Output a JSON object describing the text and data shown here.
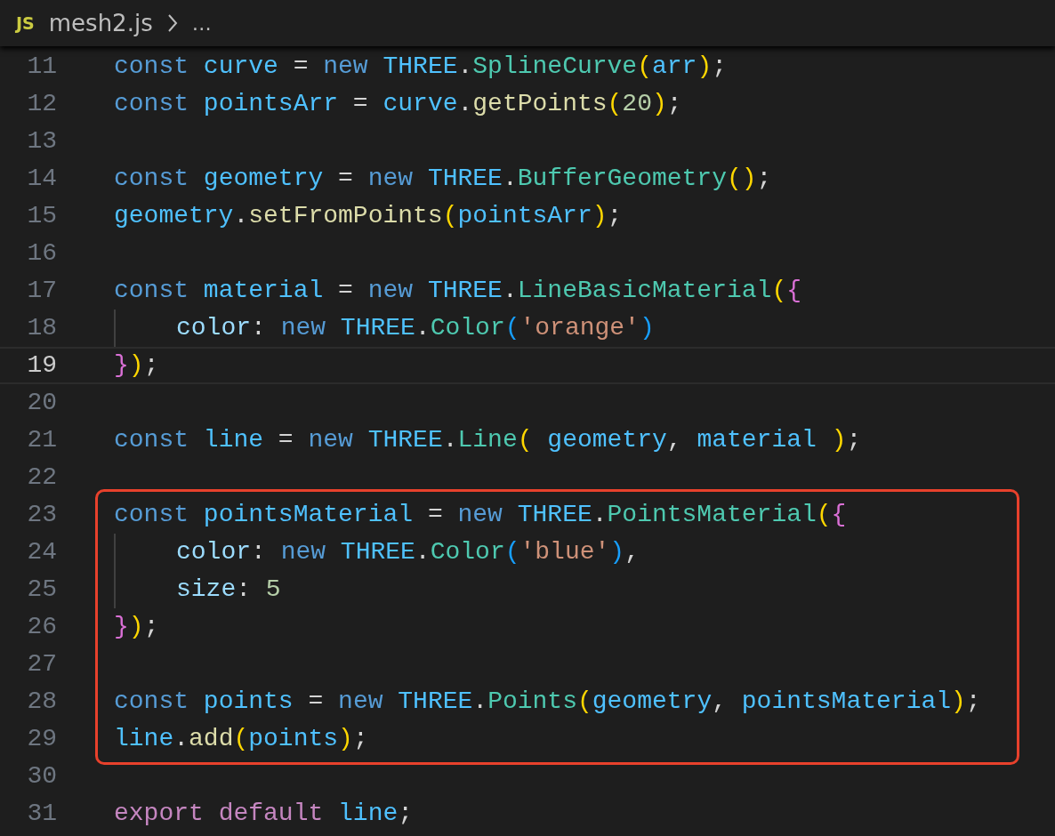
{
  "breadcrumb": {
    "file_badge": "JS",
    "file_name": "mesh2.js",
    "more": "…"
  },
  "sections": [
    {
      "boxed": false,
      "lines": [
        {
          "number": "11",
          "current": false,
          "indented": false,
          "tokens": [
            {
              "text": "const ",
              "kind": "keyword"
            },
            {
              "text": "curve",
              "kind": "variable"
            },
            {
              "text": " = ",
              "kind": "punct"
            },
            {
              "text": "new ",
              "kind": "keyword"
            },
            {
              "text": "THREE",
              "kind": "variable"
            },
            {
              "text": ".",
              "kind": "punct"
            },
            {
              "text": "SplineCurve",
              "kind": "class"
            },
            {
              "text": "(",
              "kind": "bracket1"
            },
            {
              "text": "arr",
              "kind": "variable"
            },
            {
              "text": ")",
              "kind": "bracket1"
            },
            {
              "text": ";",
              "kind": "punct"
            }
          ]
        },
        {
          "number": "12",
          "current": false,
          "indented": false,
          "tokens": [
            {
              "text": "const ",
              "kind": "keyword"
            },
            {
              "text": "pointsArr",
              "kind": "variable"
            },
            {
              "text": " = ",
              "kind": "punct"
            },
            {
              "text": "curve",
              "kind": "variable"
            },
            {
              "text": ".",
              "kind": "punct"
            },
            {
              "text": "getPoints",
              "kind": "function"
            },
            {
              "text": "(",
              "kind": "bracket1"
            },
            {
              "text": "20",
              "kind": "number"
            },
            {
              "text": ")",
              "kind": "bracket1"
            },
            {
              "text": ";",
              "kind": "punct"
            }
          ]
        },
        {
          "number": "13",
          "current": false,
          "indented": false
        },
        {
          "number": "14",
          "current": false,
          "indented": false,
          "tokens": [
            {
              "text": "const ",
              "kind": "keyword"
            },
            {
              "text": "geometry",
              "kind": "variable"
            },
            {
              "text": " = ",
              "kind": "punct"
            },
            {
              "text": "new ",
              "kind": "keyword"
            },
            {
              "text": "THREE",
              "kind": "variable"
            },
            {
              "text": ".",
              "kind": "punct"
            },
            {
              "text": "BufferGeometry",
              "kind": "class"
            },
            {
              "text": "()",
              "kind": "bracket1"
            },
            {
              "text": ";",
              "kind": "punct"
            }
          ]
        },
        {
          "number": "15",
          "current": false,
          "indented": false,
          "tokens": [
            {
              "text": "geometry",
              "kind": "variable"
            },
            {
              "text": ".",
              "kind": "punct"
            },
            {
              "text": "setFromPoints",
              "kind": "function"
            },
            {
              "text": "(",
              "kind": "bracket1"
            },
            {
              "text": "pointsArr",
              "kind": "variable"
            },
            {
              "text": ")",
              "kind": "bracket1"
            },
            {
              "text": ";",
              "kind": "punct"
            }
          ]
        },
        {
          "number": "16",
          "current": false,
          "indented": false
        },
        {
          "number": "17",
          "current": false,
          "indented": false,
          "tokens": [
            {
              "text": "const ",
              "kind": "keyword"
            },
            {
              "text": "material",
              "kind": "variable"
            },
            {
              "text": " = ",
              "kind": "punct"
            },
            {
              "text": "new ",
              "kind": "keyword"
            },
            {
              "text": "THREE",
              "kind": "variable"
            },
            {
              "text": ".",
              "kind": "punct"
            },
            {
              "text": "LineBasicMaterial",
              "kind": "class"
            },
            {
              "text": "(",
              "kind": "bracket1"
            },
            {
              "text": "{",
              "kind": "bracket2"
            }
          ]
        },
        {
          "number": "18",
          "current": false,
          "indented": true,
          "tokens": [
            {
              "text": "color",
              "kind": "property"
            },
            {
              "text": ": ",
              "kind": "punct"
            },
            {
              "text": "new ",
              "kind": "keyword"
            },
            {
              "text": "THREE",
              "kind": "variable"
            },
            {
              "text": ".",
              "kind": "punct"
            },
            {
              "text": "Color",
              "kind": "class"
            },
            {
              "text": "(",
              "kind": "bracket3"
            },
            {
              "text": "'orange'",
              "kind": "string"
            },
            {
              "text": ")",
              "kind": "bracket3"
            }
          ]
        },
        {
          "number": "19",
          "current": true,
          "indented": false,
          "tokens": [
            {
              "text": "}",
              "kind": "bracket2"
            },
            {
              "text": ")",
              "kind": "bracket1"
            },
            {
              "text": ";",
              "kind": "punct"
            }
          ]
        },
        {
          "number": "20",
          "current": false,
          "indented": false
        },
        {
          "number": "21",
          "current": false,
          "indented": false,
          "tokens": [
            {
              "text": "const ",
              "kind": "keyword"
            },
            {
              "text": "line",
              "kind": "variable"
            },
            {
              "text": " = ",
              "kind": "punct"
            },
            {
              "text": "new ",
              "kind": "keyword"
            },
            {
              "text": "THREE",
              "kind": "variable"
            },
            {
              "text": ".",
              "kind": "punct"
            },
            {
              "text": "Line",
              "kind": "class"
            },
            {
              "text": "(",
              "kind": "bracket1"
            },
            {
              "text": " geometry",
              "kind": "variable"
            },
            {
              "text": ", ",
              "kind": "punct"
            },
            {
              "text": "material ",
              "kind": "variable"
            },
            {
              "text": ")",
              "kind": "bracket1"
            },
            {
              "text": ";",
              "kind": "punct"
            }
          ]
        },
        {
          "number": "22",
          "current": false,
          "indented": false
        }
      ]
    },
    {
      "boxed": true,
      "lines": [
        {
          "number": "23",
          "current": false,
          "indented": false,
          "tokens": [
            {
              "text": "const ",
              "kind": "keyword"
            },
            {
              "text": "pointsMaterial",
              "kind": "variable"
            },
            {
              "text": " = ",
              "kind": "punct"
            },
            {
              "text": "new ",
              "kind": "keyword"
            },
            {
              "text": "THREE",
              "kind": "variable"
            },
            {
              "text": ".",
              "kind": "punct"
            },
            {
              "text": "PointsMaterial",
              "kind": "class"
            },
            {
              "text": "(",
              "kind": "bracket1"
            },
            {
              "text": "{",
              "kind": "bracket2"
            }
          ]
        },
        {
          "number": "24",
          "current": false,
          "indented": true,
          "tokens": [
            {
              "text": "color",
              "kind": "property"
            },
            {
              "text": ": ",
              "kind": "punct"
            },
            {
              "text": "new ",
              "kind": "keyword"
            },
            {
              "text": "THREE",
              "kind": "variable"
            },
            {
              "text": ".",
              "kind": "punct"
            },
            {
              "text": "Color",
              "kind": "class"
            },
            {
              "text": "(",
              "kind": "bracket3"
            },
            {
              "text": "'blue'",
              "kind": "string"
            },
            {
              "text": ")",
              "kind": "bracket3"
            },
            {
              "text": ",",
              "kind": "punct"
            }
          ]
        },
        {
          "number": "25",
          "current": false,
          "indented": true,
          "tokens": [
            {
              "text": "size",
              "kind": "property"
            },
            {
              "text": ": ",
              "kind": "punct"
            },
            {
              "text": "5",
              "kind": "number"
            }
          ]
        },
        {
          "number": "26",
          "current": false,
          "indented": false,
          "tokens": [
            {
              "text": "}",
              "kind": "bracket2"
            },
            {
              "text": ")",
              "kind": "bracket1"
            },
            {
              "text": ";",
              "kind": "punct"
            }
          ]
        },
        {
          "number": "27",
          "current": false,
          "indented": false
        },
        {
          "number": "28",
          "current": false,
          "indented": false,
          "tokens": [
            {
              "text": "const ",
              "kind": "keyword"
            },
            {
              "text": "points",
              "kind": "variable"
            },
            {
              "text": " = ",
              "kind": "punct"
            },
            {
              "text": "new ",
              "kind": "keyword"
            },
            {
              "text": "THREE",
              "kind": "variable"
            },
            {
              "text": ".",
              "kind": "punct"
            },
            {
              "text": "Points",
              "kind": "class"
            },
            {
              "text": "(",
              "kind": "bracket1"
            },
            {
              "text": "geometry",
              "kind": "variable"
            },
            {
              "text": ", ",
              "kind": "punct"
            },
            {
              "text": "pointsMaterial",
              "kind": "variable"
            },
            {
              "text": ")",
              "kind": "bracket1"
            },
            {
              "text": ";",
              "kind": "punct"
            }
          ]
        },
        {
          "number": "29",
          "current": false,
          "indented": false,
          "tokens": [
            {
              "text": "line",
              "kind": "variable"
            },
            {
              "text": ".",
              "kind": "punct"
            },
            {
              "text": "add",
              "kind": "function"
            },
            {
              "text": "(",
              "kind": "bracket1"
            },
            {
              "text": "points",
              "kind": "variable"
            },
            {
              "text": ")",
              "kind": "bracket1"
            },
            {
              "text": ";",
              "kind": "punct"
            }
          ]
        }
      ]
    },
    {
      "boxed": false,
      "lines": [
        {
          "number": "30",
          "current": false,
          "indented": false
        },
        {
          "number": "31",
          "current": false,
          "indented": false,
          "tokens": [
            {
              "text": "export ",
              "kind": "control"
            },
            {
              "text": "default ",
              "kind": "control"
            },
            {
              "text": "line",
              "kind": "variable"
            },
            {
              "text": ";",
              "kind": "punct"
            }
          ]
        }
      ]
    }
  ]
}
